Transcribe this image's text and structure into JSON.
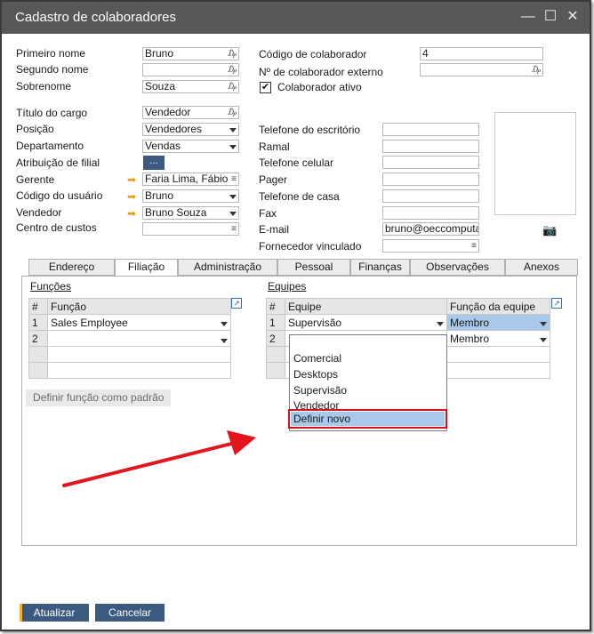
{
  "window": {
    "title": "Cadastro de colaboradores",
    "minimize": "—",
    "maximize": "☐",
    "close": "✕"
  },
  "left_fields": {
    "primeiro_nome": {
      "label": "Primeiro nome",
      "value": "Bruno"
    },
    "segundo_nome": {
      "label": "Segundo nome",
      "value": ""
    },
    "sobrenome": {
      "label": "Sobrenome",
      "value": "Souza"
    },
    "titulo_cargo": {
      "label": "Título do cargo",
      "value": "Vendedor"
    },
    "posicao": {
      "label": "Posição",
      "value": "Vendedores"
    },
    "departamento": {
      "label": "Departamento",
      "value": "Vendas"
    },
    "atribuicao_filial": {
      "label": "Atribuição de filial",
      "button": "..."
    },
    "gerente": {
      "label": "Gerente",
      "value": "Faria Lima, Fábio"
    },
    "codigo_usuario": {
      "label": "Código do usuário",
      "value": "Bruno"
    },
    "vendedor": {
      "label": "Vendedor",
      "value": "Bruno Souza"
    },
    "centro_custos": {
      "label": "Centro de custos",
      "value": ""
    }
  },
  "right_fields": {
    "codigo_colaborador": {
      "label": "Código de colaborador",
      "value": "4"
    },
    "numero_externo": {
      "label": "Nº de colaborador externo",
      "value": ""
    },
    "colaborador_ativo": {
      "label": "Colaborador ativo",
      "checked": "✔"
    },
    "telefone_escritorio": {
      "label": "Telefone do escritório",
      "value": ""
    },
    "ramal": {
      "label": "Ramal",
      "value": ""
    },
    "telefone_celular": {
      "label": "Telefone celular",
      "value": ""
    },
    "pager": {
      "label": "Pager",
      "value": ""
    },
    "telefone_casa": {
      "label": "Telefone de casa",
      "value": ""
    },
    "fax": {
      "label": "Fax",
      "value": ""
    },
    "email": {
      "label": "E-mail",
      "value": "bruno@oeccomputa"
    },
    "fornecedor_vinculado": {
      "label": "Fornecedor vinculado",
      "value": ""
    }
  },
  "tabs": [
    {
      "label": "Endereço"
    },
    {
      "label": "Filiação"
    },
    {
      "label": "Administração"
    },
    {
      "label": "Pessoal"
    },
    {
      "label": "Finanças"
    },
    {
      "label": "Observações"
    },
    {
      "label": "Anexos"
    }
  ],
  "funcoes": {
    "title": "Funções",
    "headers": [
      "#",
      "Função"
    ],
    "rows": [
      {
        "n": "1",
        "value": "Sales Employee"
      },
      {
        "n": "2",
        "value": ""
      }
    ],
    "set_default_button": "Definir função como padrão"
  },
  "equipes": {
    "title": "Equipes",
    "headers": [
      "#",
      "Equipe",
      "Função da equipe"
    ],
    "rows": [
      {
        "n": "1",
        "equipe": "Supervisão",
        "funcao": "Membro"
      },
      {
        "n": "2",
        "equipe": "",
        "funcao": "Membro"
      }
    ],
    "dropdown_options": [
      "Comercial",
      "Desktops",
      "Supervisão",
      "Vendedor"
    ],
    "define_new": "Definir novo"
  },
  "footer": {
    "update_button": "Atualizar",
    "cancel_button": "Cancelar"
  },
  "colors": {
    "titlebar": "#58585a",
    "button": "#3c5a80",
    "highlight_border": "#d3141b",
    "selection": "#a9c9ea",
    "annotation_arrow": "#e3161b"
  }
}
